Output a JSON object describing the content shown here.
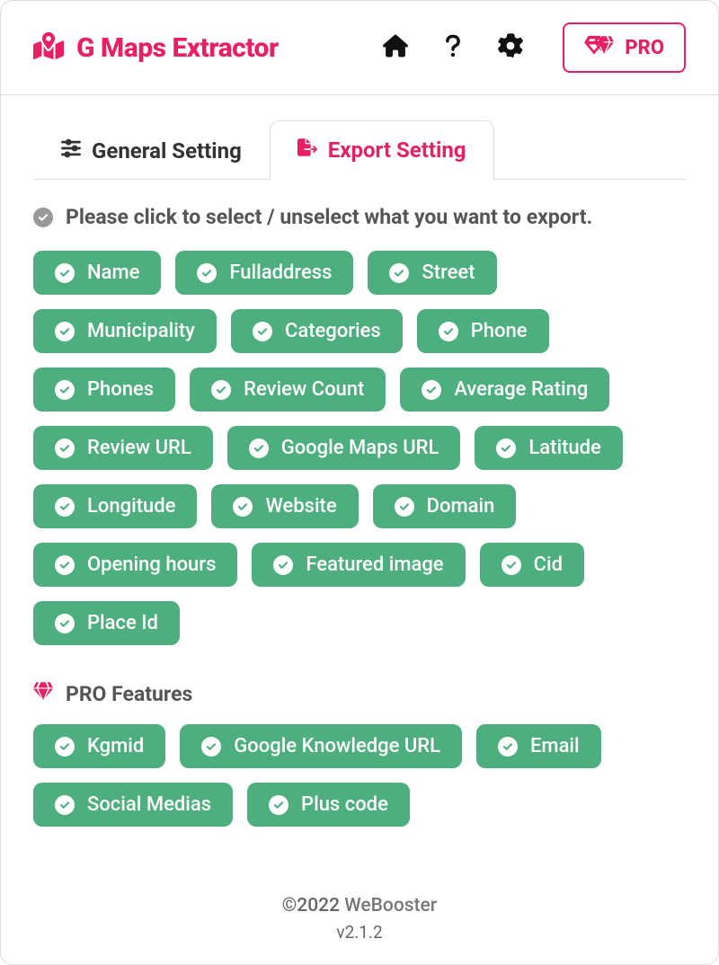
{
  "header": {
    "title": "G Maps Extractor",
    "pro_label": "PRO"
  },
  "tabs": {
    "general": "General Setting",
    "export": "Export Setting"
  },
  "instruction": "Please click to select / unselect what you want to export.",
  "export_fields": [
    "Name",
    "Fulladdress",
    "Street",
    "Municipality",
    "Categories",
    "Phone",
    "Phones",
    "Review Count",
    "Average Rating",
    "Review URL",
    "Google Maps URL",
    "Latitude",
    "Longitude",
    "Website",
    "Domain",
    "Opening hours",
    "Featured image",
    "Cid",
    "Place Id"
  ],
  "pro_section_title": "PRO Features",
  "pro_fields": [
    "Kgmid",
    "Google Knowledge URL",
    "Email",
    "Social Medias",
    "Plus code"
  ],
  "footer": {
    "copyright_prefix": "©2022 ",
    "brand": "WeBooster",
    "version": "v2.1.2"
  }
}
